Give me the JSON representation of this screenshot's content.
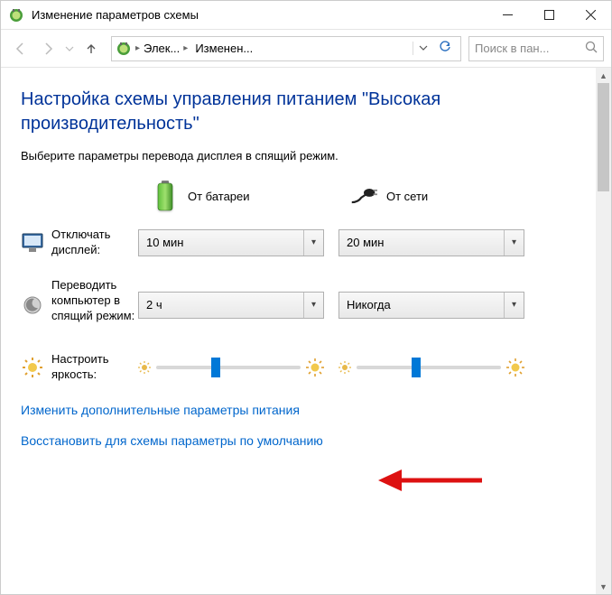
{
  "window": {
    "title": "Изменение параметров схемы"
  },
  "breadcrumb": {
    "seg1": "Элек...",
    "seg2": "Изменен..."
  },
  "search": {
    "placeholder": "Поиск в пан..."
  },
  "heading": "Настройка схемы управления питанием \"Высокая производительность\"",
  "subtext": "Выберите параметры перевода дисплея в спящий режим.",
  "columns": {
    "battery": "От батареи",
    "plugged": "От сети"
  },
  "rows": {
    "display_off": {
      "label": "Отключать дисплей:",
      "battery_value": "10 мин",
      "plugged_value": "20 мин"
    },
    "sleep": {
      "label": "Переводить компьютер в спящий режим:",
      "battery_value": "2 ч",
      "plugged_value": "Никогда"
    },
    "brightness": {
      "label": "Настроить яркость:",
      "battery_percent": 40,
      "plugged_percent": 40
    }
  },
  "links": {
    "advanced": "Изменить дополнительные параметры питания",
    "restore": "Восстановить для схемы параметры по умолчанию"
  }
}
